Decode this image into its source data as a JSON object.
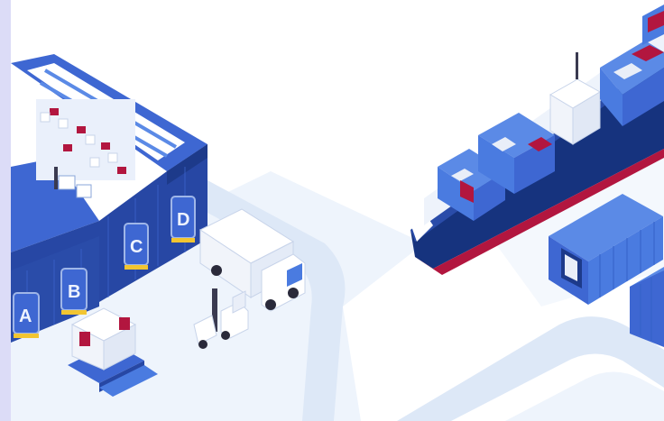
{
  "illustration": {
    "warehouse": {
      "bay_doors": [
        "A",
        "B",
        "C",
        "D"
      ]
    },
    "colors": {
      "strip": "#dcdcf7",
      "ground": "#eef4fc",
      "road": "#dde8f7",
      "road_edge": "#c7d6ee",
      "warehouse_dark": "#2747a4",
      "warehouse_mid": "#3e67d2",
      "warehouse_light": "#5b8ae6",
      "container_blue": "#4a7be0",
      "container_light": "#e9eef8",
      "container_crimson": "#b2163f",
      "hull_navy": "#16337e",
      "hull_red": "#b2163f"
    }
  }
}
